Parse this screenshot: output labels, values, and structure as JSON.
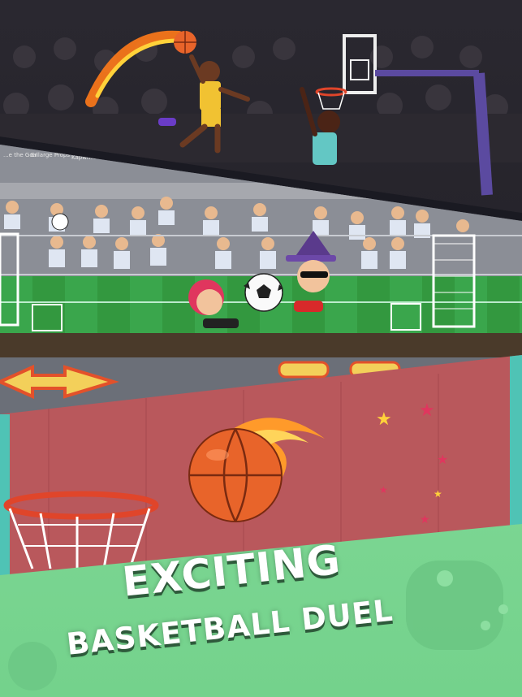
{
  "caption": {
    "line1": "EXCITING",
    "line2": "BASKETBALL DUEL"
  },
  "soccer_panel": {
    "power_hints": [
      "...e the Goal",
      "Enlarge Props",
      "Kapwn..."
    ]
  },
  "icons": {
    "left_arrow": "arrow-left-icon",
    "right_arrow": "arrow-right-icon",
    "gamepad": "gamepad-icon"
  },
  "colors": {
    "caption_green": "#7fd896",
    "basket_bg": "#b9585c",
    "pitch_green": "#3aa64c",
    "ball_orange": "#e8642a"
  }
}
